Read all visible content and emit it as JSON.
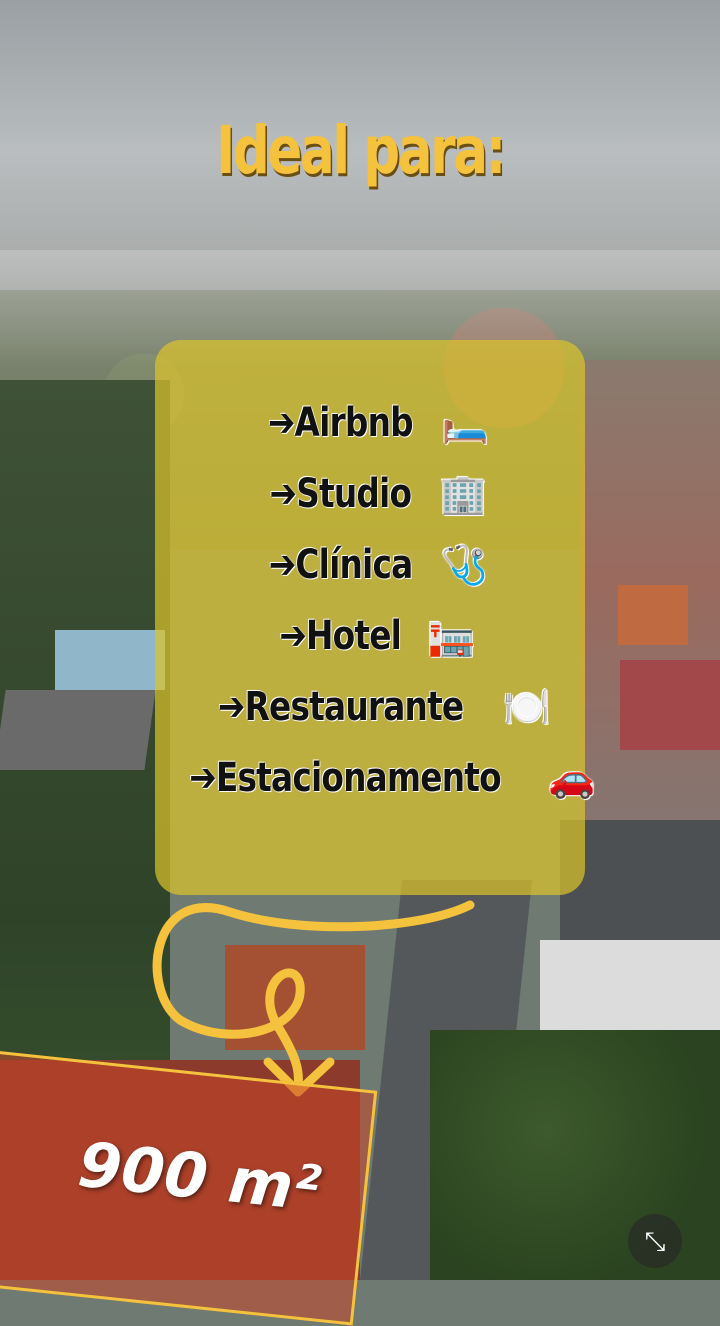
{
  "title": "Ideal para:",
  "items": [
    {
      "label": "➔Airbnb",
      "emoji": "🛏️"
    },
    {
      "label": "➔Studio",
      "emoji": "🏢"
    },
    {
      "label": "➔Clínica",
      "emoji": "🩺"
    },
    {
      "label": "➔Hotel",
      "emoji": "🏣"
    },
    {
      "label": "➔Restaurante",
      "emoji": "🍽️"
    },
    {
      "label": "➔Estacionamento",
      "emoji": "🚗"
    }
  ],
  "area": "900 m²",
  "icons": {
    "curly_arrow": "curly-arrow-icon",
    "expand": "collapse-icon"
  },
  "colors": {
    "accent": "#f4c23c",
    "panel": "#ddc42a"
  }
}
